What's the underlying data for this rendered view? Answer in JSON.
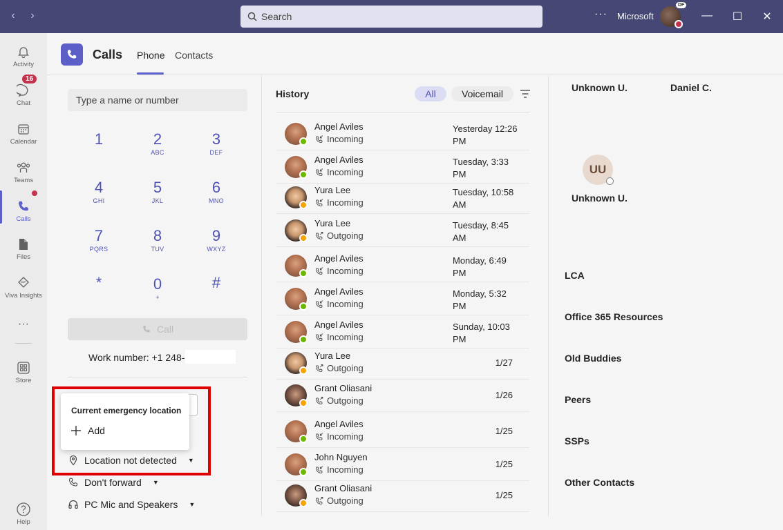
{
  "titlebar": {
    "search_placeholder": "Search",
    "more": "···",
    "org": "Microsoft",
    "avatar_badge": "DF",
    "controls": [
      "—",
      "☐",
      "✕"
    ]
  },
  "rail": {
    "items": [
      {
        "label": "Activity",
        "icon": "bell-icon"
      },
      {
        "label": "Chat",
        "icon": "chat-icon"
      },
      {
        "label": "Calendar",
        "icon": "calendar-icon"
      },
      {
        "label": "Teams",
        "icon": "teams-icon"
      },
      {
        "label": "Calls",
        "icon": "phone-icon"
      },
      {
        "label": "Files",
        "icon": "file-icon"
      },
      {
        "label": "Viva Insights",
        "icon": "insights-icon"
      },
      {
        "label": "···",
        "icon": "more-icon"
      },
      {
        "label": "Store",
        "icon": "store-icon"
      },
      {
        "label": "Help",
        "icon": "help-icon"
      }
    ],
    "chat_badge": "16",
    "active": "Calls"
  },
  "header": {
    "title": "Calls",
    "tabs": [
      {
        "label": "Phone",
        "active": true
      },
      {
        "label": "Contacts",
        "active": false
      }
    ]
  },
  "dialpad": {
    "placeholder": "Type a name or number",
    "keys": [
      {
        "digit": "1",
        "letters": ""
      },
      {
        "digit": "2",
        "letters": "ABC"
      },
      {
        "digit": "3",
        "letters": "DEF"
      },
      {
        "digit": "4",
        "letters": "GHI"
      },
      {
        "digit": "5",
        "letters": "JKL"
      },
      {
        "digit": "6",
        "letters": "MNO"
      },
      {
        "digit": "7",
        "letters": "PQRS"
      },
      {
        "digit": "8",
        "letters": "TUV"
      },
      {
        "digit": "9",
        "letters": "WXYZ"
      },
      {
        "digit": "*",
        "letters": ""
      },
      {
        "digit": "0",
        "letters": "+"
      },
      {
        "digit": "#",
        "letters": ""
      }
    ],
    "call_label": "Call",
    "work_number": "Work number: +1 248-"
  },
  "emergency": {
    "popup_title": "Current emergency location",
    "add_label": "Add",
    "location": "Location not detected"
  },
  "options": {
    "forward": "Don't forward",
    "device": "PC Mic and Speakers"
  },
  "history": {
    "title": "History",
    "filters": [
      "All",
      "Voicemail"
    ],
    "rows": [
      {
        "name": "Angel Aviles",
        "direction": "Incoming",
        "when": "Yesterday 12:26 PM",
        "status": "green"
      },
      {
        "name": "Angel Aviles",
        "direction": "Incoming",
        "when": "Tuesday, 3:33 PM",
        "status": "green"
      },
      {
        "name": "Yura Lee",
        "direction": "Incoming",
        "when": "Tuesday, 10:58 AM",
        "status": "orange"
      },
      {
        "name": "Yura Lee",
        "direction": "Outgoing",
        "when": "Tuesday, 8:45 AM",
        "status": "orange"
      },
      {
        "name": "Angel Aviles",
        "direction": "Incoming",
        "when": "Monday, 6:49 PM",
        "status": "green"
      },
      {
        "name": "Angel Aviles",
        "direction": "Incoming",
        "when": "Monday, 5:32 PM",
        "status": "green"
      },
      {
        "name": "Angel Aviles",
        "direction": "Incoming",
        "when": "Sunday, 10:03 PM",
        "status": "green"
      },
      {
        "name": "Yura Lee",
        "direction": "Outgoing",
        "when": "1/27",
        "status": "orange"
      },
      {
        "name": "Grant Oliasani",
        "direction": "Outgoing",
        "when": "1/26",
        "status": "orange"
      },
      {
        "name": "Angel Aviles",
        "direction": "Incoming",
        "when": "1/25",
        "status": "green"
      },
      {
        "name": "John Nguyen",
        "direction": "Incoming",
        "when": "1/25",
        "status": "green"
      },
      {
        "name": "Grant Oliasani",
        "direction": "Outgoing",
        "when": "1/25",
        "status": "orange"
      }
    ]
  },
  "speed_dial": {
    "top_names": [
      "Unknown U.",
      "Daniel C."
    ],
    "avatar_initials": "UU",
    "avatar_name": "Unknown U.",
    "groups": [
      "LCA",
      "Office 365 Resources",
      "Old Buddies",
      "Peers",
      "SSPs",
      "Other Contacts"
    ]
  },
  "colors": {
    "brand": "#5b5fc7",
    "titlebar": "#464775",
    "highlight": "#e00000",
    "available": "#6bb700",
    "away": "#f8a100"
  }
}
